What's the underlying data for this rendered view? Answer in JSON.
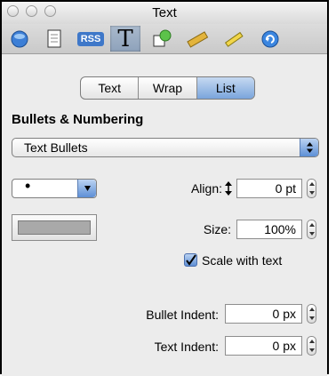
{
  "window": {
    "title": "Text"
  },
  "toolbar": {
    "items": [
      {
        "name": "document-inspector-icon"
      },
      {
        "name": "page-inspector-icon"
      },
      {
        "name": "rss-inspector-icon",
        "label": "RSS"
      },
      {
        "name": "text-inspector-icon",
        "label": "T",
        "active": true
      },
      {
        "name": "graphic-inspector-icon"
      },
      {
        "name": "metrics-inspector-icon"
      },
      {
        "name": "link-inspector-icon"
      }
    ]
  },
  "tabs": [
    {
      "label": "Text"
    },
    {
      "label": "Wrap"
    },
    {
      "label": "List",
      "selected": true
    }
  ],
  "section_title": "Bullets & Numbering",
  "style_popup": {
    "value": "Text Bullets"
  },
  "bullet_popup": {
    "value": "•"
  },
  "align": {
    "label": "Align:",
    "value": "0 pt"
  },
  "size": {
    "label": "Size:",
    "value": "100%"
  },
  "scale": {
    "label": "Scale with text",
    "checked": true
  },
  "bullet_indent": {
    "label": "Bullet Indent:",
    "value": "0 px"
  },
  "text_indent": {
    "label": "Text Indent:",
    "value": "0 px"
  },
  "colors": {
    "accent": "#5d8fd6",
    "swatch": "#a9a9a9"
  }
}
